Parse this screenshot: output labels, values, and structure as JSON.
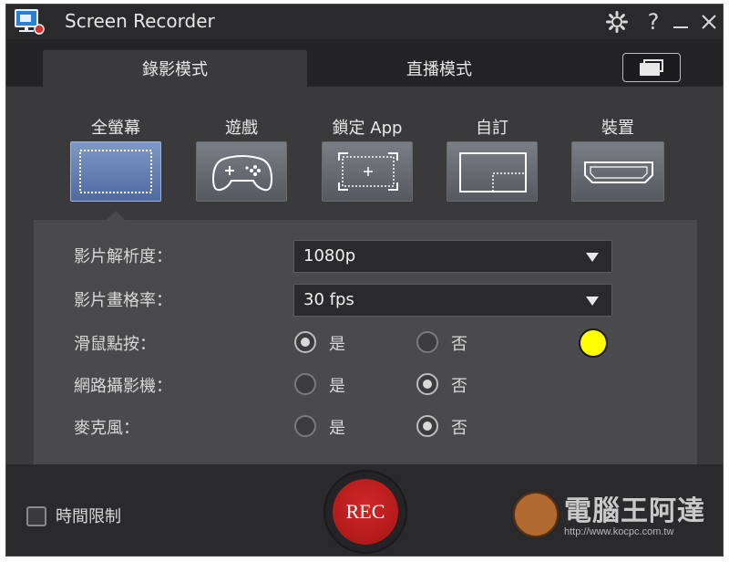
{
  "window": {
    "title": "Screen Recorder"
  },
  "titlebar": {
    "help_label": "?"
  },
  "tabs": [
    {
      "label": "錄影模式",
      "active": true
    },
    {
      "label": "直播模式",
      "active": false
    }
  ],
  "modes": [
    {
      "label": "全螢幕",
      "icon": "fullscreen-icon",
      "active": true
    },
    {
      "label": "遊戲",
      "icon": "gamepad-icon",
      "active": false
    },
    {
      "label": "鎖定 App",
      "icon": "lock-app-icon",
      "active": false
    },
    {
      "label": "自訂",
      "icon": "custom-region-icon",
      "active": false
    },
    {
      "label": "裝置",
      "icon": "hdmi-icon",
      "active": false
    }
  ],
  "settings": {
    "resolution": {
      "label": "影片解析度：",
      "value": "1080p"
    },
    "framerate": {
      "label": "影片畫格率：",
      "value": "30 fps"
    },
    "mouse_click": {
      "label": "滑鼠點按：",
      "yes": "是",
      "no": "否",
      "selected": "yes",
      "highlight_color": "#ffff00"
    },
    "webcam": {
      "label": "網路攝影機：",
      "yes": "是",
      "no": "否",
      "selected": "no"
    },
    "microphone": {
      "label": "麥克風：",
      "yes": "是",
      "no": "否",
      "selected": "no"
    }
  },
  "bottom": {
    "time_limit_label": "時間限制",
    "time_limit_checked": false,
    "rec_label": "REC"
  },
  "watermark": {
    "title": "電腦王阿達",
    "url": "http://www.kocpc.com.tw"
  },
  "colors": {
    "accent": "#5b78b0",
    "rec": "#c01e1e",
    "background": "#3a3a3c"
  }
}
